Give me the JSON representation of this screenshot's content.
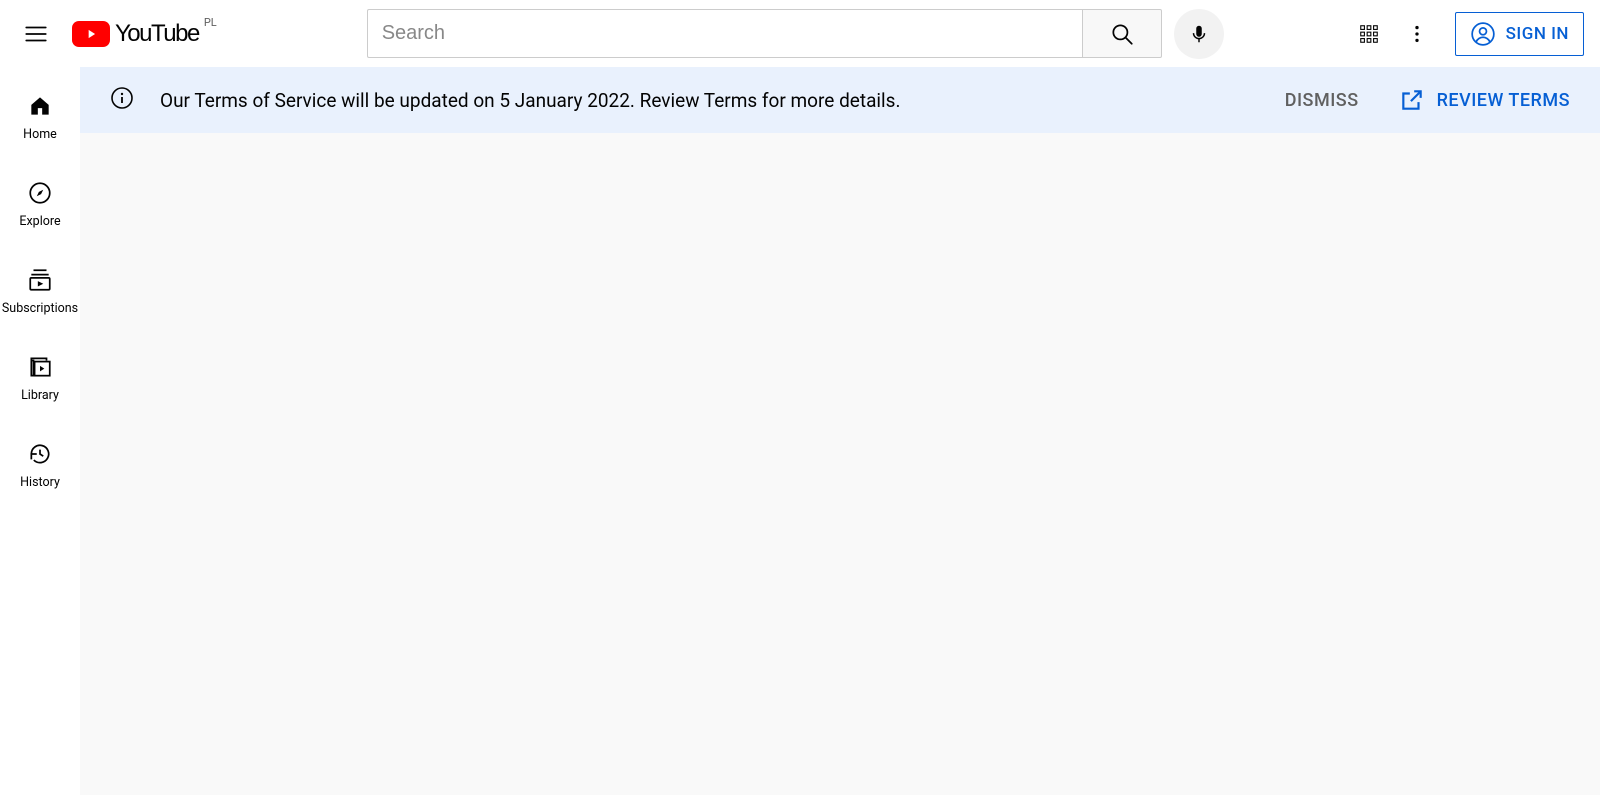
{
  "logo": {
    "text": "YouTube",
    "country": "PL"
  },
  "search": {
    "placeholder": "Search"
  },
  "signin": {
    "label": "SIGN IN"
  },
  "sidebar": {
    "items": [
      {
        "label": "Home"
      },
      {
        "label": "Explore"
      },
      {
        "label": "Subscriptions"
      },
      {
        "label": "Library"
      },
      {
        "label": "History"
      }
    ]
  },
  "banner": {
    "text": "Our Terms of Service will be updated on 5 January 2022. Review Terms for more details.",
    "dismiss": "DISMISS",
    "review": "REVIEW TERMS"
  }
}
